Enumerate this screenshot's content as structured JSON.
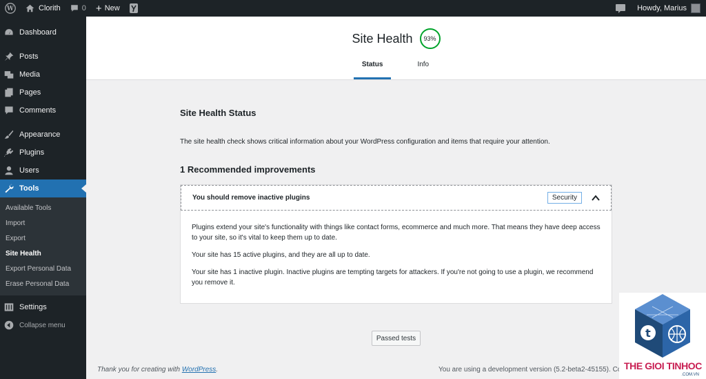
{
  "adminbar": {
    "site_name": "Clorith",
    "comments_count": "0",
    "new_label": "New",
    "howdy": "Howdy, Marius"
  },
  "sidebar": {
    "items": [
      {
        "label": "Dashboard",
        "icon": "dashboard-icon"
      },
      {
        "label": "Posts",
        "icon": "pin-icon"
      },
      {
        "label": "Media",
        "icon": "media-icon"
      },
      {
        "label": "Pages",
        "icon": "pages-icon"
      },
      {
        "label": "Comments",
        "icon": "comment-icon"
      },
      {
        "label": "Appearance",
        "icon": "brush-icon"
      },
      {
        "label": "Plugins",
        "icon": "plugin-icon"
      },
      {
        "label": "Users",
        "icon": "users-icon"
      },
      {
        "label": "Tools",
        "icon": "wrench-icon"
      },
      {
        "label": "Settings",
        "icon": "settings-icon"
      },
      {
        "label": "Collapse menu",
        "icon": "collapse-icon"
      }
    ],
    "tools_submenu": [
      "Available Tools",
      "Import",
      "Export",
      "Site Health",
      "Export Personal Data",
      "Erase Personal Data"
    ]
  },
  "header": {
    "title": "Site Health",
    "score": "93%",
    "tabs": [
      "Status",
      "Info"
    ]
  },
  "main": {
    "status_heading": "Site Health Status",
    "intro": "The site health check shows critical information about your WordPress configuration and items that require your attention.",
    "recommended_heading": "1 Recommended improvements",
    "issue": {
      "title": "You should remove inactive plugins",
      "badge": "Security",
      "p1": "Plugins extend your site's functionality with things like contact forms, ecommerce and much more. That means they have deep access to your site, so it's vital to keep them up to date.",
      "p2": "Your site has 15 active plugins, and they are all up to date.",
      "p3": "Your site has 1 inactive plugin. Inactive plugins are tempting targets for attackers. If you're not going to use a plugin, we recommend you remove it."
    },
    "passed_button": "Passed tests"
  },
  "footer": {
    "thanks_prefix": "Thank you for creating with ",
    "thanks_link": "WordPress",
    "thanks_suffix": ".",
    "version": "You are using a development version (5.2-beta2-45155). Co"
  },
  "watermark": {
    "text": "THE GIOI TINHOC",
    "sub": ".COM.VN"
  },
  "colors": {
    "accent": "#2271b1",
    "adminbar": "#1d2327",
    "score_ring": "#00a32a",
    "watermark_red": "#c81e52"
  }
}
